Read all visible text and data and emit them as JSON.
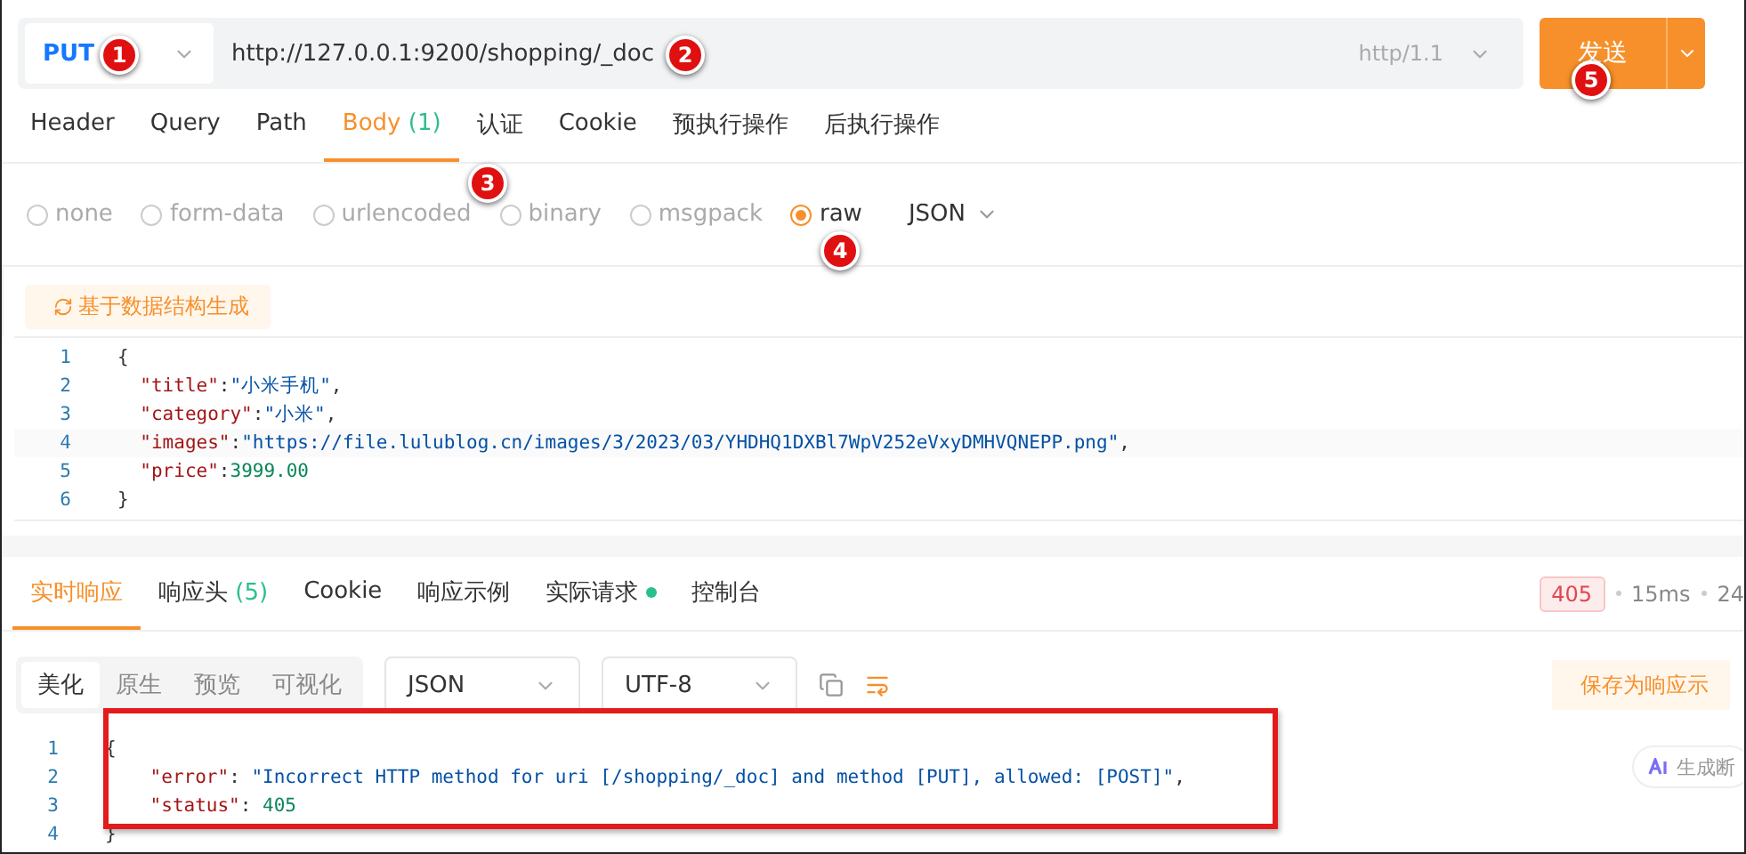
{
  "request": {
    "method": "PUT",
    "url": "http://127.0.0.1:9200/shopping/_doc",
    "protocol": "http/1.1",
    "send_label": "发送"
  },
  "request_tabs": [
    {
      "label": "Header",
      "selected": false
    },
    {
      "label": "Query",
      "selected": false
    },
    {
      "label": "Path",
      "selected": false
    },
    {
      "label": "Body",
      "count": "(1)",
      "selected": true
    },
    {
      "label": "认证",
      "selected": false
    },
    {
      "label": "Cookie",
      "selected": false
    },
    {
      "label": "预执行操作",
      "selected": false
    },
    {
      "label": "后执行操作",
      "selected": false
    }
  ],
  "body_types": [
    {
      "label": "none",
      "selected": false
    },
    {
      "label": "form-data",
      "selected": false
    },
    {
      "label": "urlencoded",
      "selected": false
    },
    {
      "label": "binary",
      "selected": false
    },
    {
      "label": "msgpack",
      "selected": false
    },
    {
      "label": "raw",
      "selected": true
    }
  ],
  "raw_format": "JSON",
  "generate_button": "基于数据结构生成",
  "request_body": [
    {
      "number": "1",
      "text": "{"
    },
    {
      "number": "2",
      "text": "  \"title\":\"小米手机\","
    },
    {
      "number": "3",
      "text": "  \"category\":\"小米\","
    },
    {
      "number": "4",
      "text": "  \"images\":\"https://file.lulublog.cn/images/3/2023/03/YHDHQ1DXBl7WpV252eVxyDMHVQNEPP.png\","
    },
    {
      "number": "5",
      "text": "  \"price\":3999.00"
    },
    {
      "number": "6",
      "text": "}"
    }
  ],
  "response_tabs": [
    {
      "label": "实时响应",
      "selected": true
    },
    {
      "label": "响应头",
      "count": "(5)",
      "selected": false
    },
    {
      "label": "Cookie",
      "selected": false
    },
    {
      "label": "响应示例",
      "selected": false
    },
    {
      "label": "实际请求",
      "dot": true,
      "selected": false
    },
    {
      "label": "控制台",
      "selected": false
    }
  ],
  "response_status": {
    "code": "405",
    "time": "15ms",
    "size": "24"
  },
  "view_modes": [
    {
      "label": "美化",
      "selected": true
    },
    {
      "label": "原生",
      "selected": false
    },
    {
      "label": "预览",
      "selected": false
    },
    {
      "label": "可视化",
      "selected": false
    }
  ],
  "response_format": "JSON",
  "response_encoding": "UTF-8",
  "save_example_button": "保存为响应示",
  "ai_button": "生成断",
  "response_body": [
    {
      "number": "1",
      "text": "{"
    },
    {
      "number": "2",
      "text": "    \"error\": \"Incorrect HTTP method for uri [/shopping/_doc] and method [PUT], allowed: [POST]\","
    },
    {
      "number": "3",
      "text": "    \"status\": 405"
    },
    {
      "number": "4",
      "text": "}"
    }
  ],
  "annotations": [
    "1",
    "2",
    "3",
    "4",
    "5"
  ]
}
